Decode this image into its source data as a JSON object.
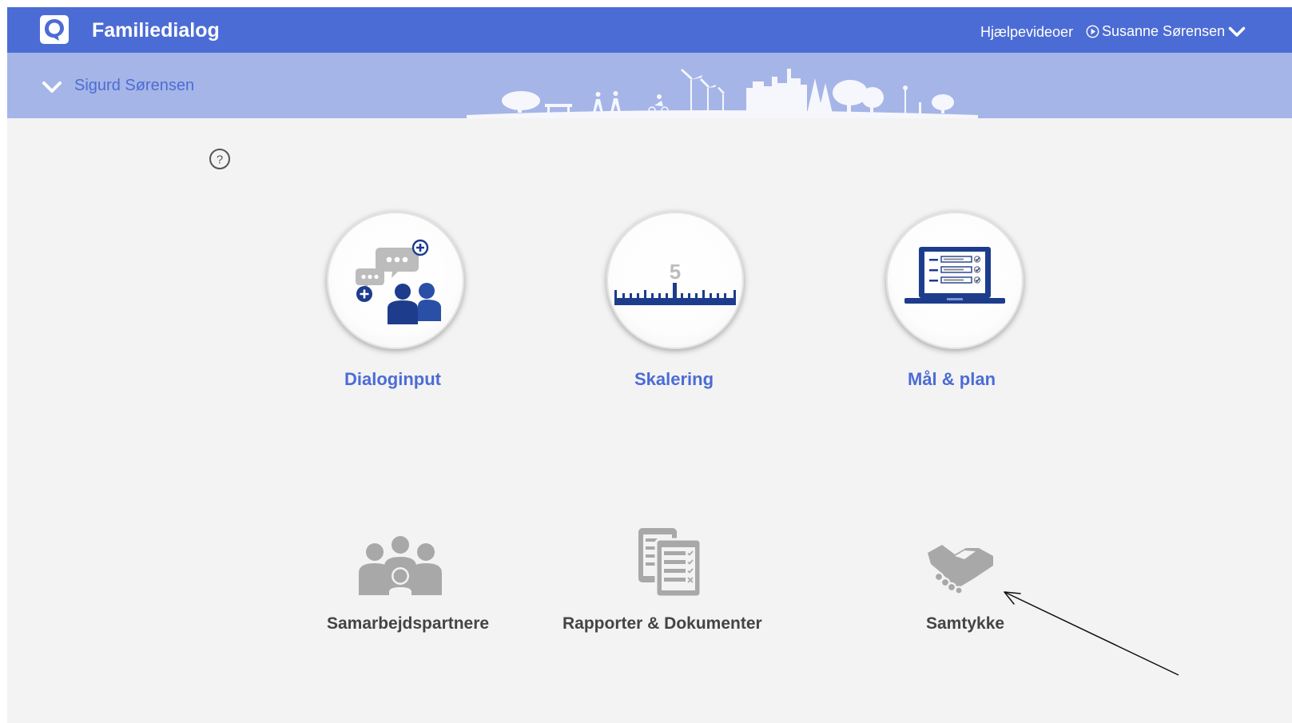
{
  "header": {
    "app_title": "Familiedialog",
    "help_videos_label": "Hjælpevideoer",
    "user_name": "Susanne Sørensen",
    "brand_color": "#4c6cd5"
  },
  "subheader": {
    "child_name": "Sigurd Sørensen",
    "background_color": "#a5b5e7"
  },
  "main_tiles": [
    {
      "label": "Dialoginput",
      "icon": "chat-people-icon"
    },
    {
      "label": "Skalering",
      "icon": "ruler-scale-icon",
      "scale_number": "5"
    },
    {
      "label": "Mål & plan",
      "icon": "laptop-checklist-icon"
    }
  ],
  "secondary_tiles": [
    {
      "label": "Samarbejdspartnere",
      "icon": "group-people-icon"
    },
    {
      "label": "Rapporter & Dokumenter",
      "icon": "documents-icon"
    },
    {
      "label": "Samtykke",
      "icon": "handshake-icon"
    }
  ]
}
